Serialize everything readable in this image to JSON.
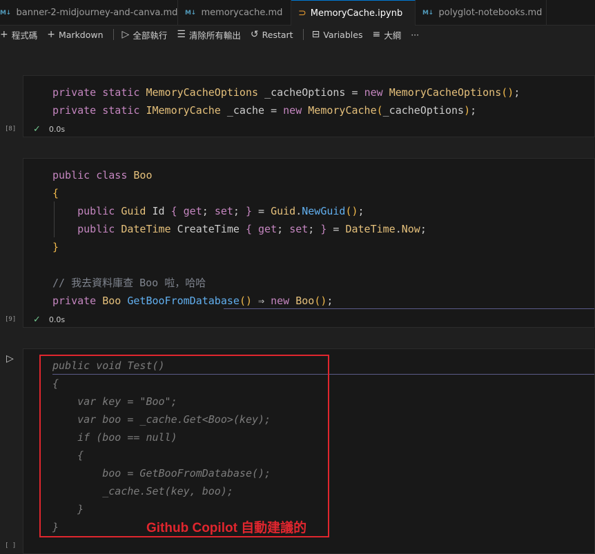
{
  "tabs": [
    {
      "icon": "M↓",
      "label": "banner-2-midjourney-and-canva.md"
    },
    {
      "icon": "M↓",
      "label": "memorycache.md"
    },
    {
      "icon": "⊃",
      "label": "MemoryCache.ipynb"
    },
    {
      "icon": "M↓",
      "label": "polyglot-notebooks.md"
    }
  ],
  "toolbar": {
    "code": "程式碼",
    "markdown": "Markdown",
    "run_all": "全部執行",
    "clear_outputs": "清除所有輸出",
    "restart": "Restart",
    "variables": "Variables",
    "outline": "大綱",
    "more": "···"
  },
  "cells": [
    {
      "exec": "[8]",
      "time": "0.0s"
    },
    {
      "exec": "[9]",
      "time": "0.0s"
    },
    {
      "exec": "[ ]"
    }
  ],
  "annotation": "Github Copilot 自動建議的"
}
